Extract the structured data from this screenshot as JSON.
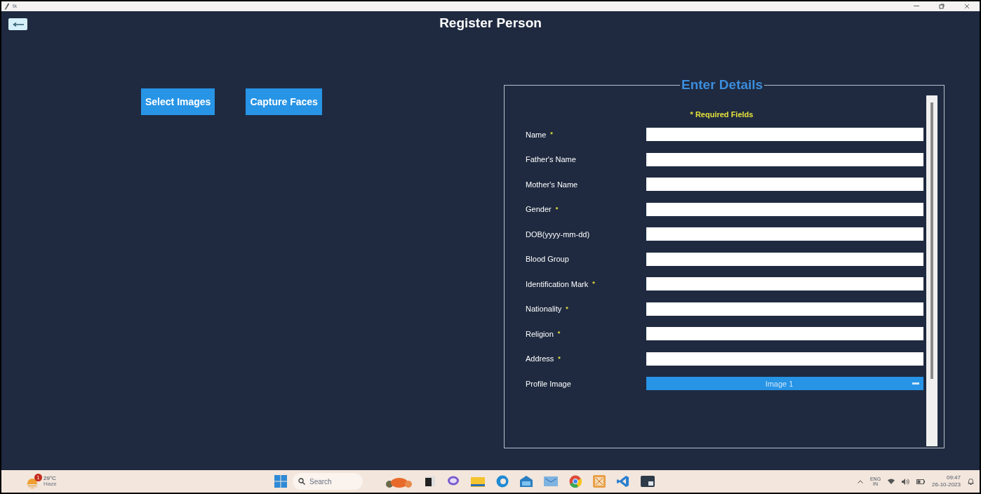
{
  "window": {
    "title": "tk"
  },
  "header": {
    "title": "Register Person"
  },
  "actions": [
    "Select Images",
    "Capture Faces"
  ],
  "form": {
    "legend": "Enter Details",
    "note": "* Required Fields",
    "fields": [
      {
        "label": "Name",
        "required": true,
        "kind": "text"
      },
      {
        "label": "Father's Name",
        "required": false,
        "kind": "text"
      },
      {
        "label": "Mother's Name",
        "required": false,
        "kind": "text"
      },
      {
        "label": "Gender",
        "required": true,
        "kind": "text"
      },
      {
        "label": "DOB(yyyy-mm-dd)",
        "required": false,
        "kind": "text"
      },
      {
        "label": "Blood Group",
        "required": false,
        "kind": "text"
      },
      {
        "label": "Identification Mark",
        "required": true,
        "kind": "text"
      },
      {
        "label": "Nationality",
        "required": true,
        "kind": "text"
      },
      {
        "label": "Religion",
        "required": true,
        "kind": "text"
      },
      {
        "label": "Address",
        "required": true,
        "kind": "text"
      },
      {
        "label": "Profile Image",
        "required": false,
        "kind": "dropdown",
        "value": "Image 1"
      }
    ],
    "required_mark": "*"
  },
  "taskbar": {
    "weather": {
      "badge": "1",
      "temp": "29°C",
      "condition": "Haze"
    },
    "search": "Search",
    "tray": {
      "lang": "ENG",
      "region": "IN",
      "time": "09:47",
      "date": "26-10-2023"
    }
  }
}
